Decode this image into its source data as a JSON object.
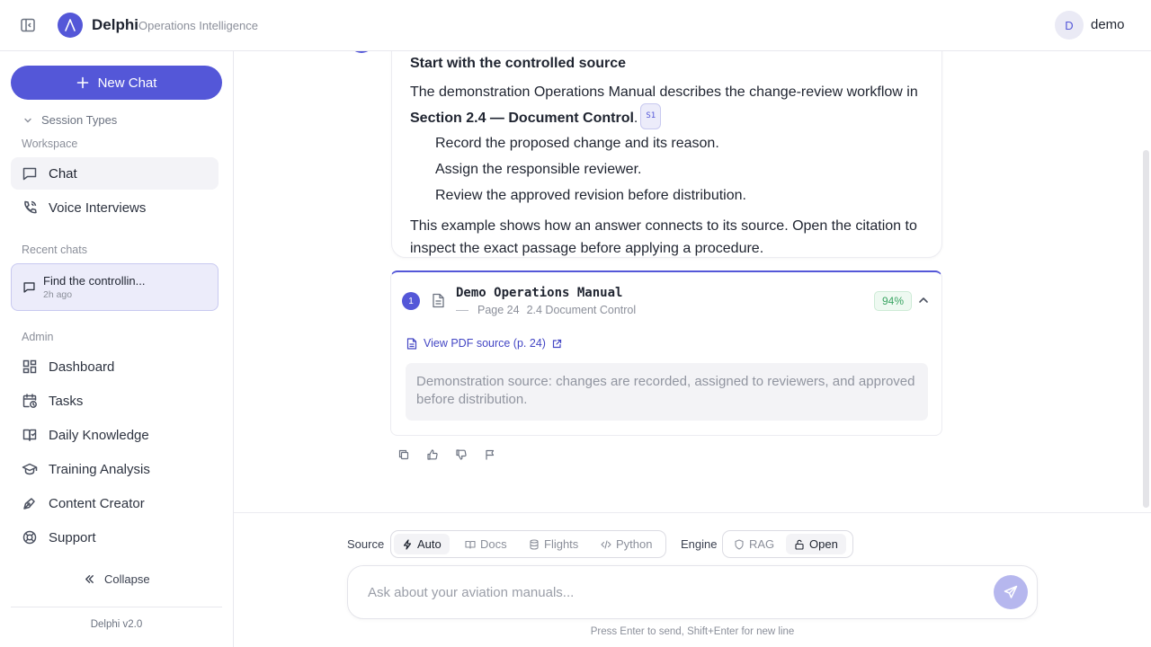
{
  "header": {
    "brand": "Delphi",
    "tagline": "Operations Intelligence",
    "user_initial": "D",
    "user_name": "demo"
  },
  "sidebar": {
    "new_chat_label": "New Chat",
    "session_types_label": "Session Types",
    "workspace_label": "Workspace",
    "workspace_items": [
      {
        "label": "Chat",
        "icon": "chat-icon",
        "active": true
      },
      {
        "label": "Voice Interviews",
        "icon": "phone-icon",
        "active": false
      }
    ],
    "recent_label": "Recent chats",
    "recent_chats": [
      {
        "title": "Find the controllin...",
        "time": "2h ago"
      }
    ],
    "admin_label": "Admin",
    "admin_items": [
      {
        "label": "Dashboard",
        "icon": "dashboard-icon"
      },
      {
        "label": "Tasks",
        "icon": "calendar-clock-icon"
      },
      {
        "label": "Daily Knowledge",
        "icon": "book-icon"
      },
      {
        "label": "Training Analysis",
        "icon": "graduation-cap-icon"
      },
      {
        "label": "Content Creator",
        "icon": "pen-tool-icon"
      },
      {
        "label": "Support",
        "icon": "lifebuoy-icon"
      }
    ],
    "collapse_label": "Collapse",
    "version": "Delphi v2.0"
  },
  "message": {
    "heading": "Start with the controlled source",
    "intro_text": "The demonstration Operations Manual describes the change-review workflow in",
    "intro_bold": "Section 2.4 — Document Control",
    "intro_end": ".",
    "citation": "S1",
    "steps": [
      "Record the proposed change and its reason.",
      "Assign the responsible reviewer.",
      "Review the approved revision before distribution."
    ],
    "outro": "This example shows how an answer connects to its source. Open the citation to inspect the exact passage before applying a procedure."
  },
  "source": {
    "number": "1",
    "title": "Demo Operations Manual",
    "page": "Page 24",
    "section": "2.4 Document Control",
    "score": "94%",
    "link_text": "View PDF source (p. 24)",
    "excerpt": "Demonstration source: changes are recorded, assigned to reviewers, and approved before distribution."
  },
  "composer": {
    "source_label": "Source",
    "source_options": [
      {
        "label": "Auto",
        "icon": "bolt-icon",
        "active": true
      },
      {
        "label": "Docs",
        "icon": "book-open-icon",
        "active": false
      },
      {
        "label": "Flights",
        "icon": "database-icon",
        "active": false
      },
      {
        "label": "Python",
        "icon": "code-icon",
        "active": false
      }
    ],
    "engine_label": "Engine",
    "engine_options": [
      {
        "label": "RAG",
        "icon": "shield-icon",
        "active": false
      },
      {
        "label": "Open",
        "icon": "unlock-icon",
        "active": true
      }
    ],
    "placeholder": "Ask about your aviation manuals...",
    "hint": "Press Enter to send, Shift+Enter for new line"
  },
  "colors": {
    "accent": "#5457d8",
    "score_green": "#3ca564"
  }
}
